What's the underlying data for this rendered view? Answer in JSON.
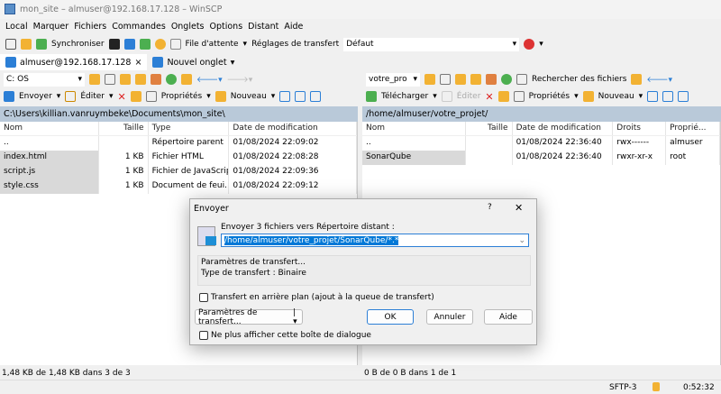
{
  "window": {
    "title": "mon_site – almuser@192.168.17.128 – WinSCP"
  },
  "menu": [
    "Local",
    "Marquer",
    "Fichiers",
    "Commandes",
    "Onglets",
    "Options",
    "Distant",
    "Aide"
  ],
  "toolbar": {
    "synchronize": "Synchroniser",
    "queue": "File d'attente",
    "transfer_settings_label": "Réglages de transfert",
    "transfer_settings_value": "Défaut"
  },
  "tabs": {
    "session": "almuser@192.168.17.128",
    "new_tab": "Nouvel onglet",
    "close": "×"
  },
  "left": {
    "drive": "C: OS",
    "upload": "Envoyer",
    "edit": "Éditer",
    "properties": "Propriétés",
    "new": "Nouveau",
    "path": "C:\\Users\\killian.vanruymbeke\\Documents\\mon_site\\",
    "columns": [
      "Nom",
      "Taille",
      "Type",
      "Date de modification"
    ],
    "rows": [
      [
        "..",
        "",
        "Répertoire parent",
        "01/08/2024 22:09:02"
      ],
      [
        "index.html",
        "1 KB",
        "Fichier HTML",
        "01/08/2024 22:08:28"
      ],
      [
        "script.js",
        "1 KB",
        "Fichier de JavaScript",
        "01/08/2024 22:09:36"
      ],
      [
        "style.css",
        "1 KB",
        "Document de feui...",
        "01/08/2024 22:09:12"
      ]
    ],
    "status": "1,48 KB de 1,48 KB dans 3 de 3"
  },
  "right": {
    "drive": "votre_pro",
    "find": "Rechercher des fichiers",
    "download": "Télécharger",
    "edit": "Éditer",
    "properties": "Propriétés",
    "new": "Nouveau",
    "path": "/home/almuser/votre_projet/",
    "columns": [
      "Nom",
      "Taille",
      "Date de modification",
      "Droits",
      "Proprié..."
    ],
    "rows": [
      [
        "..",
        "",
        "01/08/2024 22:36:40",
        "rwx------",
        "almuser"
      ],
      [
        "SonarQube",
        "",
        "01/08/2024 22:36:40",
        "rwxr-xr-x",
        "root"
      ]
    ],
    "status": "0 B de 0 B dans 1 de 1"
  },
  "statusbar": {
    "protocol": "SFTP-3",
    "time": "0:52:32"
  },
  "dialog": {
    "title": "Envoyer",
    "help": "?",
    "close": "✕",
    "label": "Envoyer 3 fichiers vers Répertoire distant :",
    "target": "/home/almuser/votre_projet/SonarQube/*.*",
    "group_title": "Paramètres de transfert...",
    "transfer_type": "Type de transfert : Binaire",
    "background": "Transfert en arrière plan (ajout à la queue de transfert)",
    "settings_button": "Paramètres de transfert...",
    "ok": "OK",
    "cancel": "Annuler",
    "help_button": "Aide",
    "dont_show": "Ne plus afficher cette boîte de dialogue"
  }
}
